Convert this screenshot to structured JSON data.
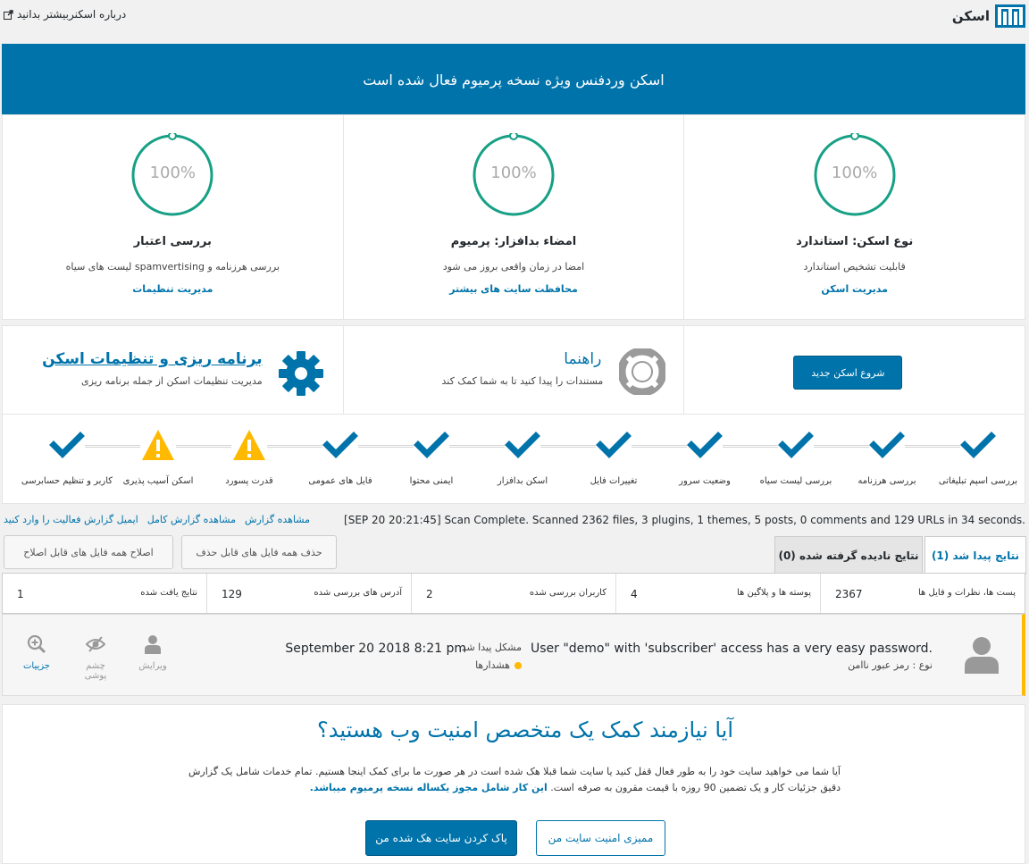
{
  "header": {
    "brand_name": "اسکن",
    "about_link": "درباره اسکنربیشتر بدانید",
    "brand_logo_icon": "castle-logo-icon",
    "external_icon": "external-link-icon"
  },
  "banner": {
    "text": "اسکن وردفنس ویژه نسخه پرمیوم فعال شده است"
  },
  "stats": [
    {
      "percent": "100%",
      "title": "نوع اسکن: استاندارد",
      "desc": "قابلیت تشخیص استاندارد",
      "link": "مدیریت اسکن"
    },
    {
      "percent": "100%",
      "title": "امضاء بدافزار: پرمیوم",
      "desc": "امضا در زمان واقعی بروز می شود",
      "link": "محافظت سایت های بیشتر"
    },
    {
      "percent": "100%",
      "title": "بررسی اعتبار",
      "desc": "بررسی هرزنامه و spamvertising لیست های سیاه",
      "link": "مدیریت تنظیمات"
    }
  ],
  "actions": {
    "new_scan_button": "شروع اسکن جدید",
    "help_title": "راهنما",
    "help_desc": "مستندات را پیدا کنید تا به شما کمک کند",
    "help_icon": "lifebuoy-icon",
    "schedule_title": "برنامه ریزی و تنظیمات اسکن",
    "schedule_desc": "مدیریت تنظیمات اسکن از جمله برنامه ریزی",
    "schedule_icon": "gear-icon"
  },
  "checks": [
    {
      "label": "بررسی اسپم تبلیغاتی",
      "status": "ok"
    },
    {
      "label": "بررسی هرزنامه",
      "status": "ok"
    },
    {
      "label": "بررسی لیست سیاه",
      "status": "ok"
    },
    {
      "label": "وضعیت سرور",
      "status": "ok"
    },
    {
      "label": "تغییرات فایل",
      "status": "ok"
    },
    {
      "label": "اسکن بدافزار",
      "status": "ok"
    },
    {
      "label": "ایمنی محتوا",
      "status": "ok"
    },
    {
      "label": "فایل های عمومی",
      "status": "ok"
    },
    {
      "label": "قدرت پسورد",
      "status": "warning"
    },
    {
      "label": "اسکن آسیب پذیری",
      "status": "warning"
    },
    {
      "label": "کاربر و تنظیم حسابرسی",
      "status": "ok"
    }
  ],
  "colors": {
    "accent": "#0073aa",
    "ok": "#0073aa",
    "warning": "#ffb900",
    "gauge": "#16a085"
  },
  "scan_status": "[SEP 20 20:21:45] Scan Complete. Scanned 2362 files, 3 plugins, 1 themes, 5 posts, 0 comments and 129 URLs in 34 seconds.",
  "report_links": [
    "مشاهده گزارش",
    "مشاهده گزارش کامل",
    "ایمیل گزارش فعالیت را وارد کنید"
  ],
  "bulk_buttons": {
    "delete_all": "حذف همه فایل های قابل حذف",
    "repair_all": "اصلاح همه فایل های قابل اصلاح"
  },
  "tabs": {
    "found": "نتایج پیدا شد (1)",
    "ignored": "نتایج نادیده گرفته شده (0)"
  },
  "summary": [
    {
      "label": "پست ها، نظرات و فایل ها",
      "value": "2367"
    },
    {
      "label": "پوسته ها و پلاگین ها",
      "value": "4"
    },
    {
      "label": "کاربران بررسی شده",
      "value": "2"
    },
    {
      "label": "آدرس های بررسی شده",
      "value": "129"
    },
    {
      "label": "نتایج یافت شده",
      "value": "1"
    }
  ],
  "result": {
    "title": "User \"demo\" with 'subscriber' access has a very easy password.",
    "type": "نوع : رمز عبور ناامن",
    "found_label": "مشکل پیدا شد",
    "date": "September 20 2018 8:21 pm",
    "severity": "هشدارها",
    "actions": {
      "edit": "ویرایش",
      "ignore": "چشم پوشی",
      "details": "جزییات"
    }
  },
  "promo": {
    "title": "آیا نیازمند کمک یک متخصص امنیت وب هستید؟",
    "text": "آیا شما می خواهید سایت خود را به طور فعال قفل کنید یا سایت شما قبلا هک شده است در هر صورت ما برای کمک اینجا هستیم. تمام خدمات شامل یک گزارش دقیق جزئیات کار و یک تضمین 90 روزه با قیمت مقرون به صرفه است.",
    "strong": "این کار شامل مجوز یکساله نسخه پرمیوم میباشد.",
    "primary_button": "پاک کردن سایت هک شده من",
    "secondary_button": "ممیزی امنیت سایت من"
  }
}
